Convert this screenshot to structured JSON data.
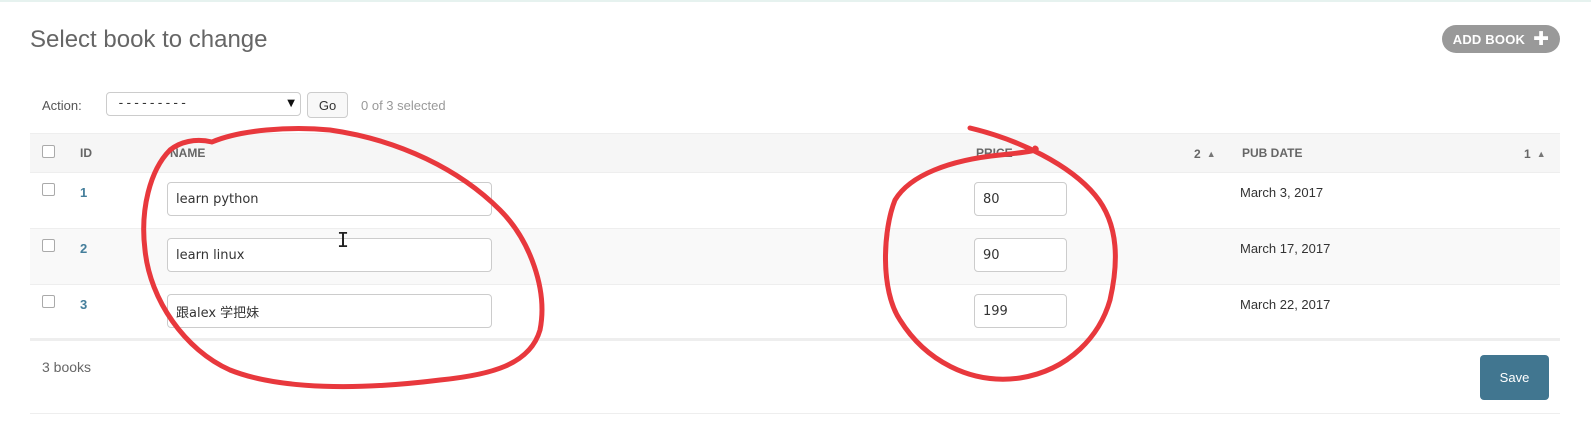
{
  "page": {
    "title": "Select book to change"
  },
  "add_button": {
    "label": "ADD BOOK",
    "icon": "plus-icon"
  },
  "actions": {
    "label": "Action:",
    "select_value": "---------",
    "go_label": "Go",
    "selected_text": "0 of 3 selected"
  },
  "table": {
    "columns": [
      {
        "label": "ID"
      },
      {
        "label": "NAME"
      },
      {
        "label": "PRICE",
        "sort_priority": "2"
      },
      {
        "label": "PUB DATE",
        "sort_priority": "1"
      }
    ],
    "rows": [
      {
        "id": "1",
        "name": "learn python",
        "price": "80",
        "pub_date": "March 3, 2017"
      },
      {
        "id": "2",
        "name": "learn linux",
        "price": "90",
        "pub_date": "March 17, 2017"
      },
      {
        "id": "3",
        "name": "跟alex 学把妹",
        "price": "199",
        "pub_date": "March 22, 2017"
      }
    ]
  },
  "footer": {
    "count_text": "3 books",
    "save_label": "Save"
  },
  "colors": {
    "link": "#447e9b",
    "save_button": "#417690",
    "add_button": "#999999",
    "annotation": "#e8383d"
  }
}
